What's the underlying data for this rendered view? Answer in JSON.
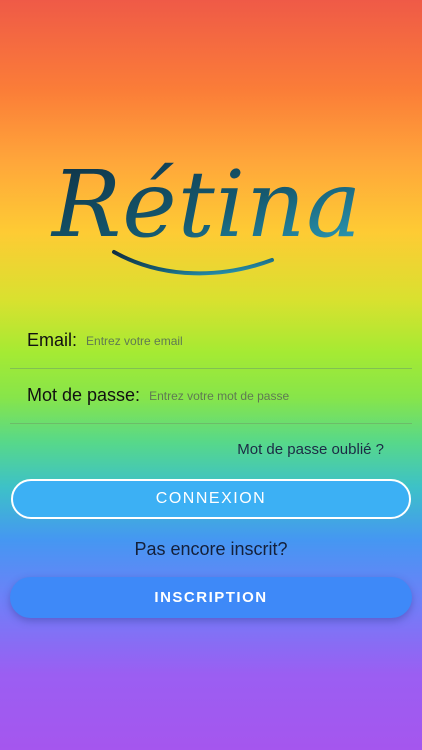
{
  "logo": {
    "text": "Rétina"
  },
  "form": {
    "email": {
      "label": "Email:",
      "placeholder": "Entrez votre email",
      "value": ""
    },
    "password": {
      "label": "Mot de passe:",
      "placeholder": "Entrez votre mot de passe",
      "value": ""
    }
  },
  "forgot_password": {
    "label": "Mot de passe oublié ?"
  },
  "login_button": {
    "label": "CONNEXION"
  },
  "signup": {
    "prompt": "Pas encore inscrit?",
    "button_label": "INSCRIPTION"
  },
  "colors": {
    "logo_dark": "#0f3346",
    "logo_light": "#2fa6c3",
    "login_button": "#3cb0f4",
    "signup_button": "#3e89f8"
  }
}
